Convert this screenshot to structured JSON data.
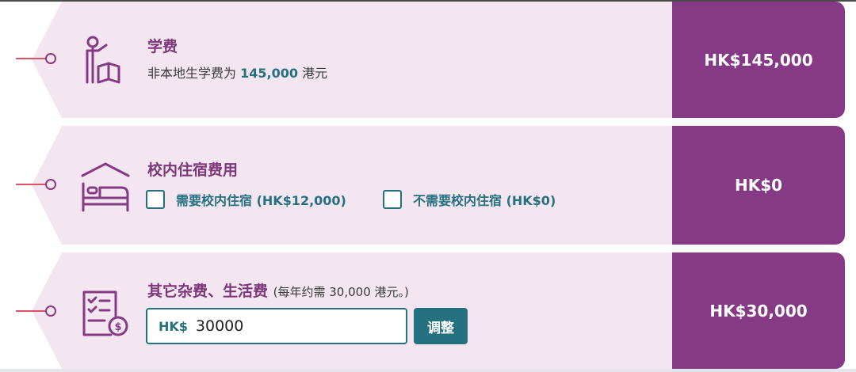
{
  "colors": {
    "accent_purple": "#863a85",
    "card_background": "#f3e6f1",
    "teal": "#257180",
    "connector_red": "#d9536a"
  },
  "tuition": {
    "icon": "teacher-with-book-icon",
    "title": "学费",
    "desc_prefix": "非本地生学费为",
    "desc_amount": "145,000",
    "desc_suffix": "港元",
    "price": "HK$145,000"
  },
  "housing": {
    "icon": "bed-with-roof-icon",
    "title": "校内住宿费用",
    "option_need": "需要校内住宿 (HK$12,000)",
    "option_no_need": "不需要校内住宿 (HK$0)",
    "price": "HK$0"
  },
  "living": {
    "icon": "checklist-dollar-icon",
    "title": "其它杂费、生活费",
    "note": "(每年约需 30,000 港元。)",
    "input_prefix": "HK$",
    "input_value": "30000",
    "adjust_label": "调整",
    "price": "HK$30,000"
  }
}
